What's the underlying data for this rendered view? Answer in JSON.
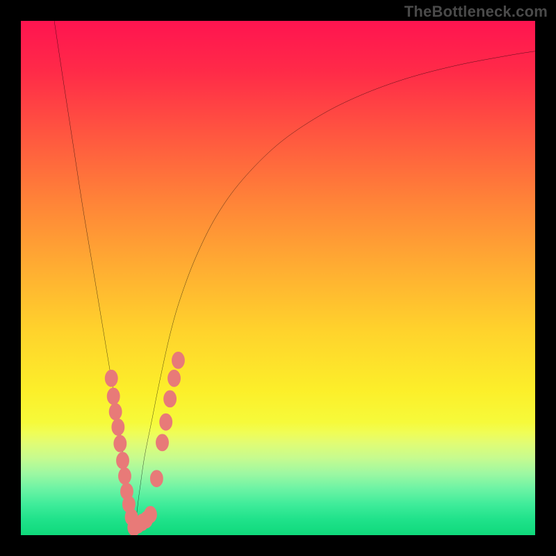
{
  "watermark": "TheBottleneck.com",
  "colors": {
    "frame": "#000000",
    "curve": "#000000",
    "marker_fill": "#e87a78",
    "marker_stroke": "#e87a78"
  },
  "gradient_stops": [
    {
      "offset": 0.0,
      "color": "#ff1450"
    },
    {
      "offset": 0.1,
      "color": "#ff2b48"
    },
    {
      "offset": 0.22,
      "color": "#ff5640"
    },
    {
      "offset": 0.35,
      "color": "#ff8338"
    },
    {
      "offset": 0.48,
      "color": "#ffad32"
    },
    {
      "offset": 0.6,
      "color": "#ffd22c"
    },
    {
      "offset": 0.72,
      "color": "#fcef2a"
    },
    {
      "offset": 0.78,
      "color": "#f6fa3a"
    },
    {
      "offset": 0.8,
      "color": "#f0fd55"
    },
    {
      "offset": 0.82,
      "color": "#e2fc73"
    },
    {
      "offset": 0.85,
      "color": "#c6fb8f"
    },
    {
      "offset": 0.88,
      "color": "#9df8a2"
    },
    {
      "offset": 0.91,
      "color": "#6cf3a4"
    },
    {
      "offset": 0.94,
      "color": "#3fec9a"
    },
    {
      "offset": 0.97,
      "color": "#1fe28a"
    },
    {
      "offset": 1.0,
      "color": "#0fd97b"
    }
  ],
  "chart_data": {
    "type": "line",
    "title": "",
    "xlabel": "",
    "ylabel": "",
    "xlim": [
      0,
      100
    ],
    "ylim": [
      0,
      100
    ],
    "grid": false,
    "curve": {
      "description": "Bottleneck-percentage-style V curve; minimum near x≈22, steep left arm, shallow asymptotic right arm",
      "x": [
        6.5,
        8,
        10,
        12,
        14,
        16,
        17.5,
        19,
        20,
        21,
        22,
        23,
        24,
        25.5,
        27,
        29,
        31,
        34,
        38,
        43,
        50,
        58,
        66,
        75,
        85,
        95,
        100
      ],
      "y": [
        100,
        90,
        77,
        64,
        52,
        40,
        31,
        22.5,
        15,
        8,
        1.5,
        8,
        15,
        22.5,
        30,
        39,
        46,
        54,
        62,
        69,
        76,
        81.5,
        85.5,
        88.8,
        91.4,
        93.3,
        94.1
      ]
    },
    "markers": {
      "description": "Highlighted sample points clustered near the trough",
      "points": [
        {
          "x": 17.6,
          "y": 30.5
        },
        {
          "x": 18.0,
          "y": 27.0
        },
        {
          "x": 18.4,
          "y": 24.0
        },
        {
          "x": 18.9,
          "y": 21.0
        },
        {
          "x": 19.3,
          "y": 17.8
        },
        {
          "x": 19.8,
          "y": 14.5
        },
        {
          "x": 20.2,
          "y": 11.5
        },
        {
          "x": 20.6,
          "y": 8.5
        },
        {
          "x": 21.0,
          "y": 6.0
        },
        {
          "x": 21.5,
          "y": 3.5
        },
        {
          "x": 22.0,
          "y": 1.5
        },
        {
          "x": 22.8,
          "y": 2.0
        },
        {
          "x": 23.6,
          "y": 2.5
        },
        {
          "x": 24.4,
          "y": 3.0
        },
        {
          "x": 25.2,
          "y": 4.0
        },
        {
          "x": 26.4,
          "y": 11.0
        },
        {
          "x": 27.5,
          "y": 18.0
        },
        {
          "x": 28.2,
          "y": 22.0
        },
        {
          "x": 29.0,
          "y": 26.5
        },
        {
          "x": 29.8,
          "y": 30.5
        },
        {
          "x": 30.6,
          "y": 34.0
        }
      ]
    }
  }
}
